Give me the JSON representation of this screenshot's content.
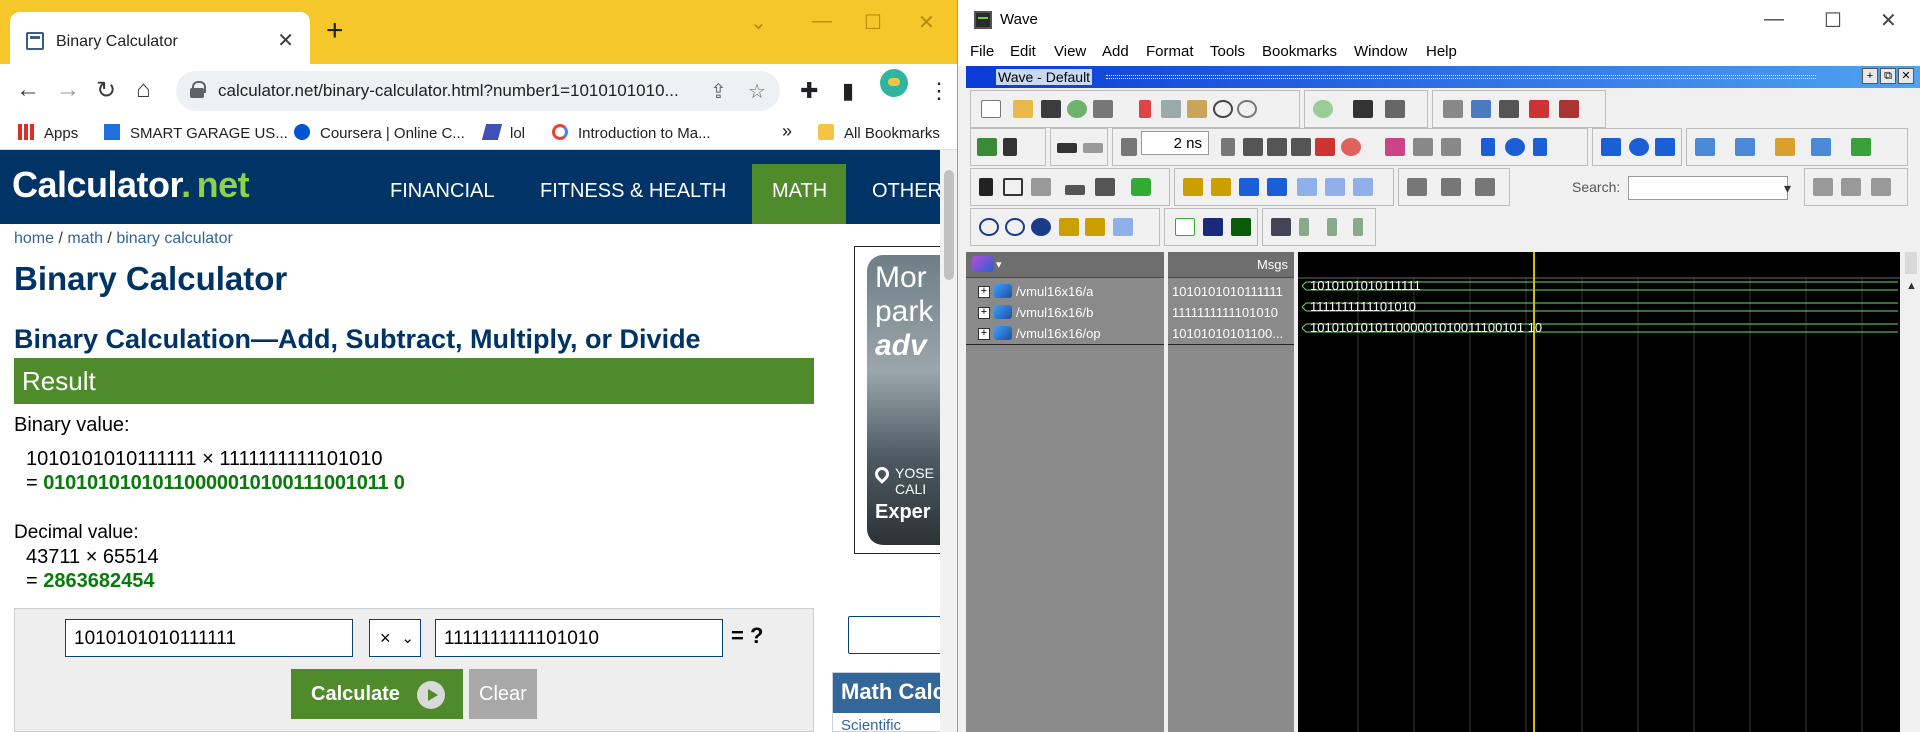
{
  "chrome": {
    "tab_title": "Binary Calculator",
    "url": "calculator.net/binary-calculator.html?number1=1010101010...",
    "bookmarks": [
      {
        "label": "Apps"
      },
      {
        "label": "SMART GARAGE US..."
      },
      {
        "label": "Coursera | Online C..."
      },
      {
        "label": "lol"
      },
      {
        "label": "Introduction to Ma..."
      },
      {
        "label": "All Bookmarks"
      }
    ]
  },
  "site": {
    "logo_main": "Calculator",
    "logo_dot": ".",
    "logo_net": "net",
    "nav": [
      "FINANCIAL",
      "FITNESS & HEALTH",
      "MATH",
      "OTHER"
    ],
    "breadcrumb": [
      "home",
      "math",
      "binary calculator"
    ],
    "breadcrumb_sep": "/",
    "title": "Binary Calculator",
    "subtitle": "Binary Calculation—Add, Subtract, Multiply, or Divide",
    "result_label": "Result",
    "binary_label": "Binary value:",
    "binary_expr": "1010101010111111 × 1111111111101010",
    "binary_eq": "=",
    "binary_result": "01010101010110000010100111001011 0",
    "decimal_label": "Decimal value:",
    "decimal_expr": "43711 × 65514",
    "decimal_eq": "=",
    "decimal_result": "2863682454",
    "input1": "1010101010111111",
    "operator": "×",
    "input2": "1111111111101010",
    "eq_q": "= ?",
    "calculate_label": "Calculate",
    "clear_label": "Clear",
    "ad_line1": "Mor",
    "ad_line2": "park",
    "ad_line3": "adv",
    "ad_loc1": "YOSE",
    "ad_loc2": "CALI",
    "ad_exp": "Exper",
    "side_head": "Math Calc",
    "side_link": "Scientific"
  },
  "wave": {
    "title": "Wave",
    "menu": [
      "File",
      "Edit",
      "View",
      "Add",
      "Format",
      "Tools",
      "Bookmarks",
      "Window",
      "Help"
    ],
    "subwindow_title": "Wave - Default",
    "time_value": "2 ns",
    "search_label": "Search:",
    "msgs_header": "Msgs",
    "signals": [
      {
        "name": "/vmul16x16/a",
        "msg": "1010101010111111",
        "wave": "1010101010111111"
      },
      {
        "name": "/vmul16x16/b",
        "msg": "1111111111101010",
        "wave": "1111111111101010"
      },
      {
        "name": "/vmul16x16/op",
        "msg": "10101010101100...",
        "wave": "101010101011000001010011100101 10"
      }
    ]
  }
}
